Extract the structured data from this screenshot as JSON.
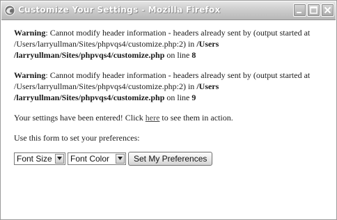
{
  "window": {
    "title": "Customize Your Settings - Mozilla Firefox",
    "controls": [
      "minimize-icon",
      "maximize-icon",
      "close-icon"
    ]
  },
  "warnings": [
    {
      "label": "Warning",
      "text_before": ": Cannot modify header information - headers already sent by (output started at /Users/larryullman/Sites/phpvqs4/customize.php:2) in ",
      "path": "/Users /larryullman/Sites/phpvqs4/customize.php",
      "text_on_line": " on line ",
      "line": "8"
    },
    {
      "label": "Warning",
      "text_before": ": Cannot modify header information - headers already sent by (output started at /Users/larryullman/Sites/phpvqs4/customize.php:2) in ",
      "path": "/Users /larryullman/Sites/phpvqs4/customize.php",
      "text_on_line": " on line ",
      "line": "9"
    }
  ],
  "confirmation": {
    "before": "Your settings have been entered! Click ",
    "link": "here",
    "after": " to see them in action."
  },
  "instructions": "Use this form to set your preferences:",
  "form": {
    "font_size_selected": "Font Size",
    "font_color_selected": "Font Color",
    "submit_label": "Set My Preferences"
  },
  "colors": {
    "link": "#444444",
    "text": "#1a1a1a"
  }
}
